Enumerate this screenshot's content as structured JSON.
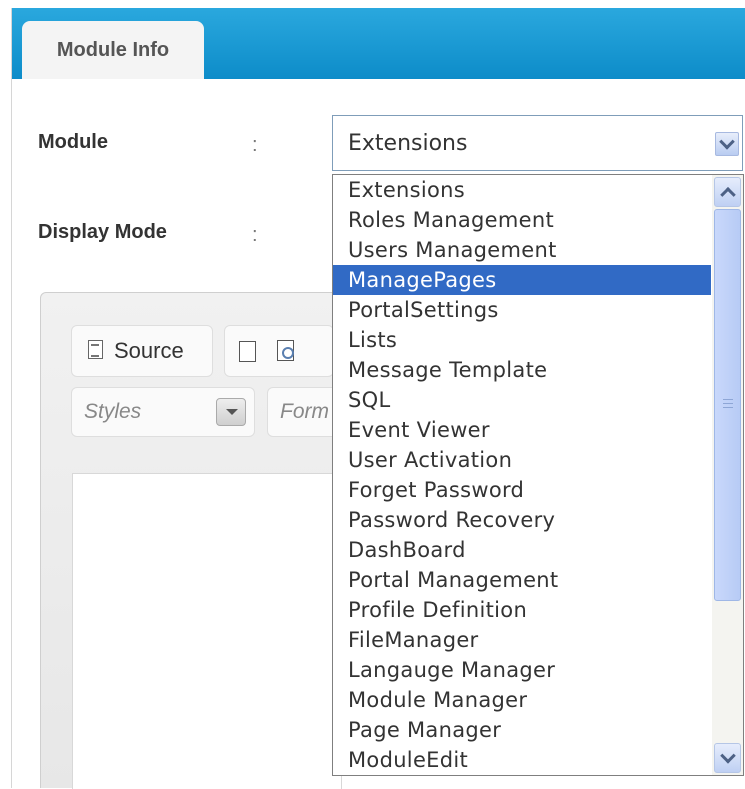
{
  "tab": {
    "label": "Module Info"
  },
  "form": {
    "module_label": "Module",
    "display_mode_label": "Display Mode",
    "colon": ":",
    "module_selected": "Extensions"
  },
  "editor": {
    "source_label": "Source",
    "styles_placeholder": "Styles",
    "format_placeholder": "Form"
  },
  "dropdown": {
    "options": [
      "Extensions",
      "Roles Management",
      "Users Management",
      "ManagePages",
      "PortalSettings",
      "Lists",
      "Message Template",
      "SQL",
      "Event Viewer",
      "User Activation",
      "Forget Password",
      "Password Recovery",
      "DashBoard",
      "Portal Management",
      "Profile Definition",
      "FileManager",
      "Langauge Manager",
      "Module Manager",
      "Page Manager",
      "ModuleEdit"
    ],
    "highlighted": "ManagePages"
  },
  "colors": {
    "tab_bar": "#1a9ad6",
    "highlight": "#316ac5"
  }
}
